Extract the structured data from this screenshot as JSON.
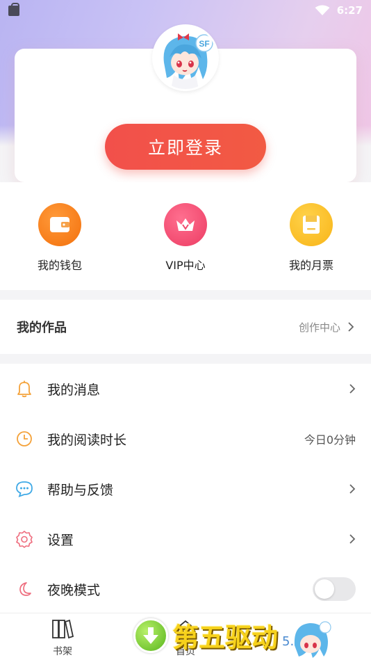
{
  "status_bar": {
    "time": "6:27"
  },
  "login": {
    "button_label": "立即登录",
    "avatar_badge": "SF"
  },
  "quick_actions": [
    {
      "label": "我的钱包",
      "icon": "wallet-icon",
      "color": "#f57c14"
    },
    {
      "label": "VIP中心",
      "icon": "crown-icon",
      "color": "#f0486b"
    },
    {
      "label": "我的月票",
      "icon": "ticket-icon",
      "color": "#f9b81e"
    }
  ],
  "works": {
    "title": "我的作品",
    "link_label": "创作中心"
  },
  "menu": [
    {
      "label": "我的消息",
      "icon": "bell-icon",
      "value": ""
    },
    {
      "label": "我的阅读时长",
      "icon": "clock-icon",
      "value": "今日0分钟"
    },
    {
      "label": "帮助与反馈",
      "icon": "chat-bubble-icon",
      "value": ""
    },
    {
      "label": "设置",
      "icon": "gear-icon",
      "value": ""
    },
    {
      "label": "夜晚模式",
      "icon": "moon-icon",
      "value": "",
      "toggle_on": false
    }
  ],
  "tabbar": [
    {
      "label": "书架",
      "icon": "bookshelf-icon"
    },
    {
      "label": "首页",
      "icon": "home-icon"
    }
  ],
  "watermark": {
    "text": "第五驱动",
    "domain": "5.cn"
  }
}
